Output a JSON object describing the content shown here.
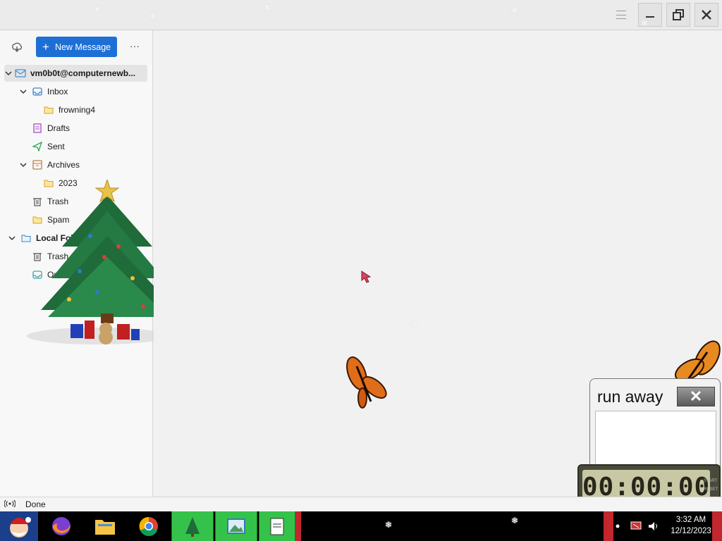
{
  "toolbar": {
    "new_message_label": "New Message",
    "more_label": "···"
  },
  "folders": {
    "account": "vm0b0t@computernewb...",
    "inbox": "Inbox",
    "inbox_sub": "frowning4",
    "drafts": "Drafts",
    "sent": "Sent",
    "archives": "Archives",
    "archives_sub": "2023",
    "trash": "Trash",
    "spam": "Spam",
    "local_folders": "Local Folders",
    "local_trash": "Trash",
    "outbox": "Outbox"
  },
  "status": {
    "text": "Done"
  },
  "runaway": {
    "title": "run away",
    "close": "✕"
  },
  "timer": {
    "display": "00:00:00",
    "side_top": "START",
    "side_bottom": "RESET"
  },
  "clock": {
    "time": "3:32 AM",
    "date": "12/12/2023"
  },
  "colors": {
    "accent": "#1d6fd6",
    "taskbar_green": "#35c24a"
  }
}
